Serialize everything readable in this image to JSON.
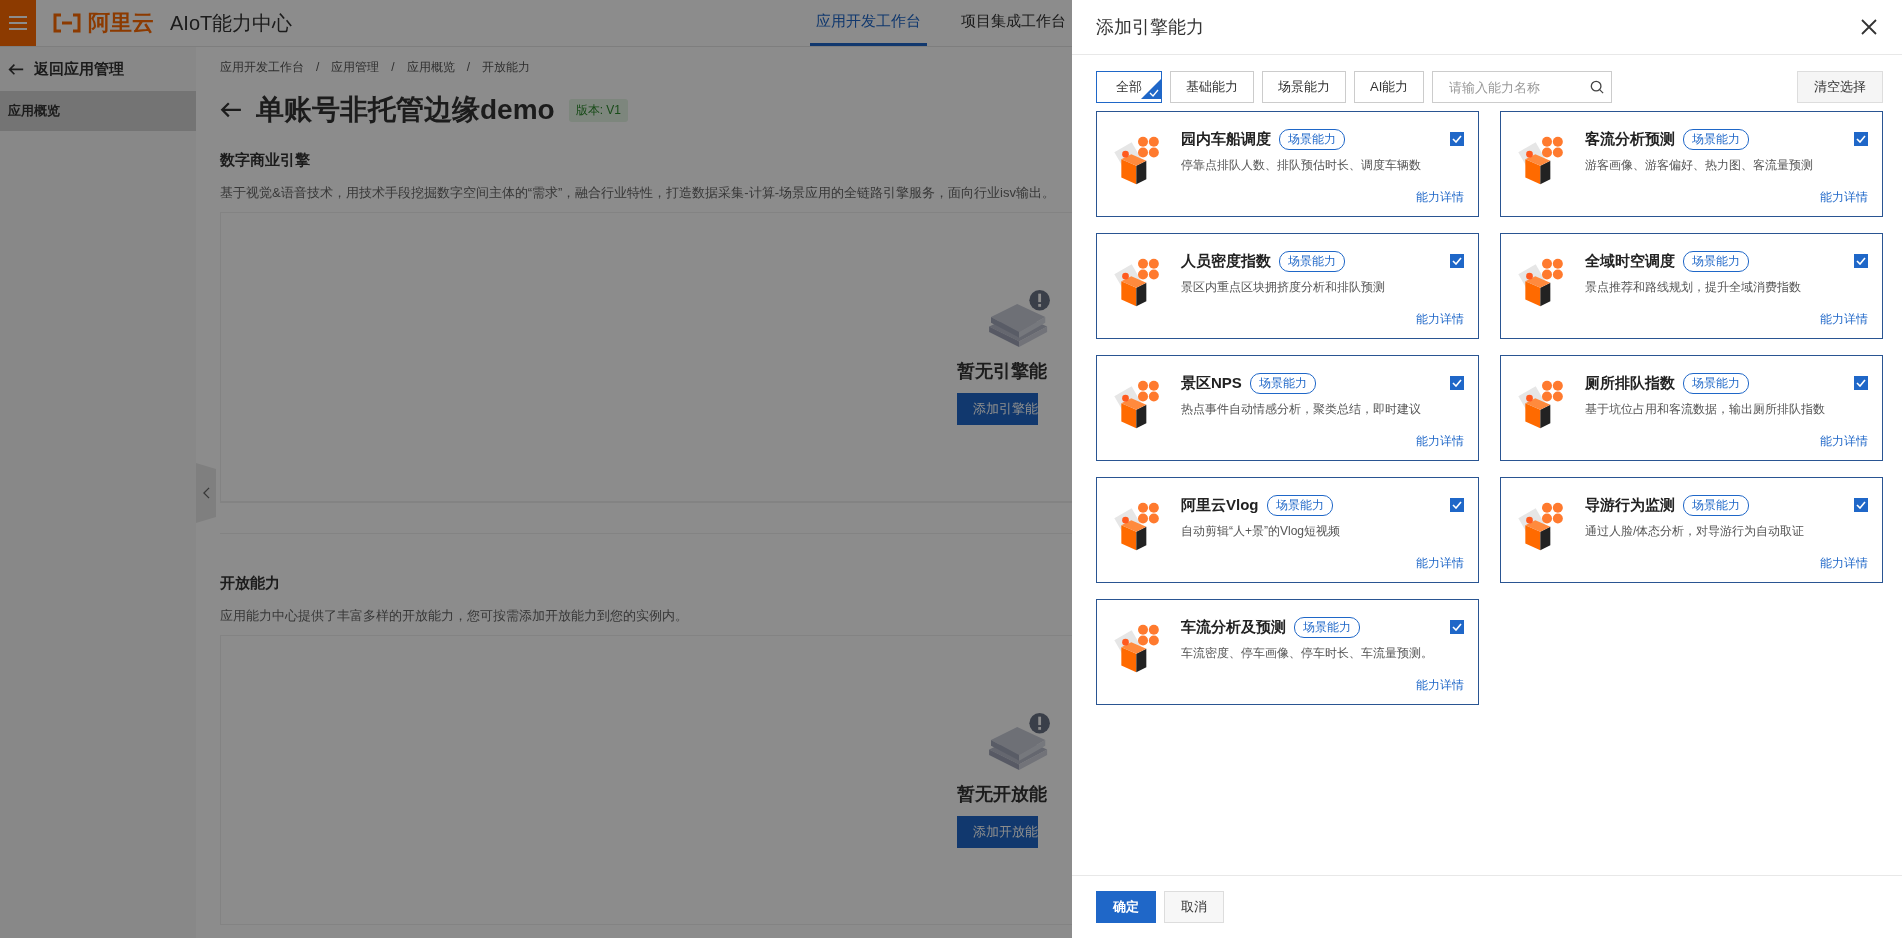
{
  "background": {
    "top_bar": {
      "brand": "阿里云",
      "product": "AIoT能力中心",
      "nav": [
        {
          "label": "应用开发工作台",
          "selected": true
        },
        {
          "label": "项目集成工作台",
          "selected": false
        }
      ]
    },
    "sidebar": {
      "back": "返回应用管理",
      "items": [
        {
          "label": "应用概览",
          "selected": true
        }
      ]
    },
    "breadcrumb": {
      "separator": "/",
      "items": [
        "应用开发工作台",
        "应用管理",
        "应用概览",
        "开放能力"
      ]
    },
    "title": "单账号非托管边缘demo",
    "version_tag": "版本: V1",
    "sections": [
      {
        "heading": "数字商业引擎",
        "description": "基于视觉&语音技术，用技术手段挖掘数字空间主体的“需求”，融合行业特性，打造数据采集-计算-场景应用的全链路引擎服务，面向行业isv输出。",
        "empty_text": "暂无引擎能",
        "button": "添加引擎能"
      },
      {
        "heading": "开放能力",
        "description": "应用能力中心提供了丰富多样的开放能力，您可按需添加开放能力到您的实例内。",
        "empty_text": "暂无开放能",
        "button": "添加开放能"
      }
    ]
  },
  "drawer": {
    "title": "添加引擎能力",
    "filters": [
      {
        "label": "全部",
        "selected": true
      },
      {
        "label": "基础能力",
        "selected": false
      },
      {
        "label": "场景能力",
        "selected": false
      },
      {
        "label": "AI能力",
        "selected": false
      }
    ],
    "search": {
      "placeholder": "请输入能力名称"
    },
    "clear_button": "清空选择",
    "cards": [
      {
        "name": "园内车船调度",
        "tag": "场景能力",
        "description": "停靠点排队人数、排队预估时长、调度车辆数",
        "checked": true,
        "link": "能力详情"
      },
      {
        "name": "客流分析预测",
        "tag": "场景能力",
        "description": "游客画像、游客偏好、热力图、客流量预测",
        "checked": true,
        "link": "能力详情"
      },
      {
        "name": "人员密度指数",
        "tag": "场景能力",
        "description": "景区内重点区块拥挤度分析和排队预测",
        "checked": true,
        "link": "能力详情"
      },
      {
        "name": "全域时空调度",
        "tag": "场景能力",
        "description": "景点推荐和路线规划，提升全域消费指数",
        "checked": true,
        "link": "能力详情"
      },
      {
        "name": "景区NPS",
        "tag": "场景能力",
        "description": "热点事件自动情感分析，聚类总结，即时建议",
        "checked": true,
        "link": "能力详情"
      },
      {
        "name": "厕所排队指数",
        "tag": "场景能力",
        "description": "基于坑位占用和客流数据，输出厕所排队指数",
        "checked": true,
        "link": "能力详情"
      },
      {
        "name": "阿里云Vlog",
        "tag": "场景能力",
        "description": "自动剪辑“人+景”的Vlog短视频",
        "checked": true,
        "link": "能力详情"
      },
      {
        "name": "导游行为监测",
        "tag": "场景能力",
        "description": "通过人脸/体态分析，对导游行为自动取证",
        "checked": true,
        "link": "能力详情"
      },
      {
        "name": "车流分析及预测",
        "tag": "场景能力",
        "description": "车流密度、停车画像、停车时长、车流量预测。",
        "checked": true,
        "link": "能力详情"
      }
    ],
    "buttons": [
      {
        "label": "确定",
        "kind": "primary"
      },
      {
        "label": "取消",
        "kind": "secondary"
      }
    ]
  }
}
